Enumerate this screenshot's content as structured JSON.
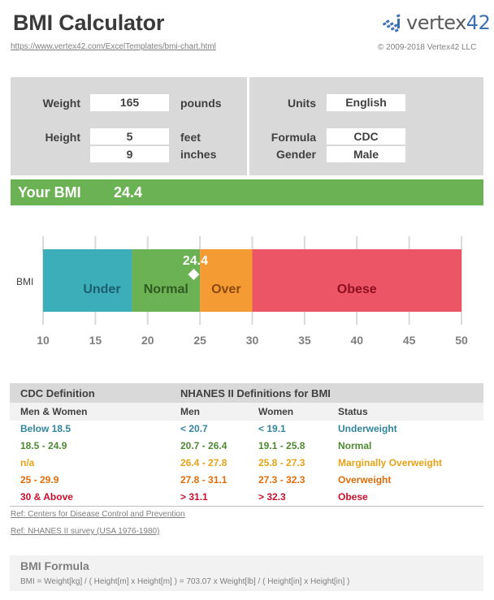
{
  "header": {
    "title": "BMI Calculator",
    "url": "https://www.vertex42.com/ExcelTemplates/bmi-chart.html",
    "logo_text": "vertex",
    "logo_num": "42",
    "copyright": "© 2009-2018 Vertex42 LLC"
  },
  "inputs": {
    "weight": {
      "label": "Weight",
      "value": "165",
      "unit": "pounds"
    },
    "height_feet": {
      "label": "Height",
      "value": "5",
      "unit": "feet"
    },
    "height_inches": {
      "value": "9",
      "unit": "inches"
    },
    "units": {
      "label": "Units",
      "value": "English"
    },
    "formula": {
      "label": "Formula",
      "value": "CDC"
    },
    "gender": {
      "label": "Gender",
      "value": "Male"
    }
  },
  "result": {
    "label": "Your BMI",
    "value": "24.4"
  },
  "chart_data": {
    "type": "bar",
    "orientation": "horizontal-stacked",
    "category": "BMI",
    "xlim": [
      10,
      50
    ],
    "xticks": [
      10,
      15,
      20,
      25,
      30,
      35,
      40,
      45,
      50
    ],
    "grid": true,
    "segments": [
      {
        "name": "Under",
        "from": 10,
        "to": 18.5,
        "color": "#3caeb9",
        "text_color": "#1e5f6e"
      },
      {
        "name": "Normal",
        "from": 18.5,
        "to": 25,
        "color": "#6ab254",
        "text_color": "#2f5a22"
      },
      {
        "name": "Over",
        "from": 25,
        "to": 30,
        "color": "#f59b33",
        "text_color": "#8a4a10"
      },
      {
        "name": "Obese",
        "from": 30,
        "to": 50,
        "color": "#eb5565",
        "text_color": "#8e1020"
      }
    ],
    "marker": {
      "value": 24.4,
      "label": "24.4"
    }
  },
  "table": {
    "header": {
      "cdc": "CDC Definition",
      "nhanes": "NHANES II Definitions for BMI"
    },
    "subheader": [
      "Men & Women",
      "Men",
      "Women",
      "Status"
    ],
    "rows": [
      {
        "cells": [
          "Below 18.5",
          "< 20.7",
          "< 19.1",
          "Underweight"
        ],
        "color": "#31859c"
      },
      {
        "cells": [
          "18.5 - 24.9",
          "20.7 - 26.4",
          "19.1 - 25.8",
          "Normal"
        ],
        "color": "#4f8a33"
      },
      {
        "cells": [
          "n/a",
          "26.4 - 27.8",
          "25.8 - 27.3",
          "Marginally Overweight"
        ],
        "color": "#e8a317"
      },
      {
        "cells": [
          "25 - 29.9",
          "27.8 - 31.1",
          "27.3 - 32.3",
          "Overweight"
        ],
        "color": "#e36c0a"
      },
      {
        "cells": [
          "30 & Above",
          "> 31.1",
          "> 32.3",
          "Obese"
        ],
        "color": "#c8102e"
      }
    ]
  },
  "refs": [
    "Ref: Centers for Disease Control and Prevention",
    "Ref: NHANES II survey (USA 1976-1980)"
  ],
  "formula": {
    "title": "BMI Formula",
    "text": "BMI = Weight[kg] / ( Height[m] x Height[m] ) = 703.07 x Weight[lb] / ( Height[in] x Height[in] )"
  }
}
